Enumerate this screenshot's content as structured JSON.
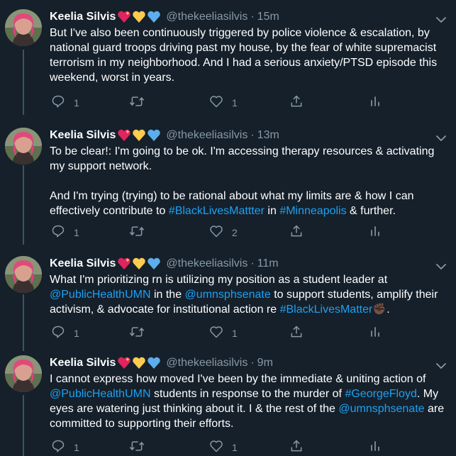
{
  "colors": {
    "background": "#15202b",
    "link": "#1da1f2",
    "muted": "#8899a6",
    "thread_line": "#3d5466"
  },
  "icons": {
    "emoji": [
      "heart-sparkle-icon",
      "yellow-heart-icon",
      "blue-heart-icon"
    ],
    "actions": [
      "reply-icon",
      "retweet-icon",
      "like-icon",
      "share-icon",
      "analytics-icon"
    ],
    "menu": "chevron-down-icon"
  },
  "tweets": [
    {
      "name": "Keelia Silvis",
      "handle": "@thekeeliasilvis",
      "separator": "·",
      "time": "15m",
      "paragraphs": [
        [
          {
            "t": "But I've also been continuously triggered by police violence & escalation, by national guard troops driving past my house, by the fear of white supremacist terrorism in my neighborhood. And I had a serious anxiety/PTSD episode this weekend, worst in years.",
            "link": false
          }
        ]
      ],
      "reply_count": "1",
      "retweet_count": "",
      "like_count": "1"
    },
    {
      "name": "Keelia Silvis",
      "handle": "@thekeeliasilvis",
      "separator": "·",
      "time": "13m",
      "paragraphs": [
        [
          {
            "t": "To be clear!: I'm going to be ok. I'm accessing therapy resources & activating my support network.",
            "link": false
          }
        ],
        [
          {
            "t": "And I'm trying (trying) to be rational about what my limits are & how I can effectively contribute to ",
            "link": false
          },
          {
            "t": "#BlackLivesMattter",
            "link": true
          },
          {
            "t": " in ",
            "link": false
          },
          {
            "t": "#Minneapolis",
            "link": true
          },
          {
            "t": " & further.",
            "link": false
          }
        ]
      ],
      "reply_count": "1",
      "retweet_count": "",
      "like_count": "2"
    },
    {
      "name": "Keelia Silvis",
      "handle": "@thekeeliasilvis",
      "separator": "·",
      "time": "11m",
      "paragraphs": [
        [
          {
            "t": "What I'm prioritizing rn is utilizing my position as a student leader at ",
            "link": false
          },
          {
            "t": "@PublicHealthUMN",
            "link": true
          },
          {
            "t": " in the ",
            "link": false
          },
          {
            "t": "@umnsphsenate",
            "link": true
          },
          {
            "t": " to support students, amplify their activism, & advocate for institutional action re ",
            "link": false
          },
          {
            "t": "#BlackLivesMatter",
            "link": true
          },
          {
            "t": "✊🏿",
            "link": false
          },
          {
            "t": ".",
            "link": false
          }
        ]
      ],
      "reply_count": "1",
      "retweet_count": "",
      "like_count": "1"
    },
    {
      "name": "Keelia Silvis",
      "handle": "@thekeeliasilvis",
      "separator": "·",
      "time": "9m",
      "paragraphs": [
        [
          {
            "t": "I cannot express how moved I've been by the immediate & uniting action of ",
            "link": false
          },
          {
            "t": "@PublicHealthUMN",
            "link": true
          },
          {
            "t": " students in response to the murder of ",
            "link": false
          },
          {
            "t": "#GeorgeFloyd",
            "link": true
          },
          {
            "t": ". My eyes are watering just thinking about it. I & the rest of the ",
            "link": false
          },
          {
            "t": "@umnsphsenate",
            "link": true
          },
          {
            "t": " are committed to supporting their efforts.",
            "link": false
          }
        ]
      ],
      "reply_count": "1",
      "retweet_count": "",
      "like_count": "1"
    }
  ]
}
